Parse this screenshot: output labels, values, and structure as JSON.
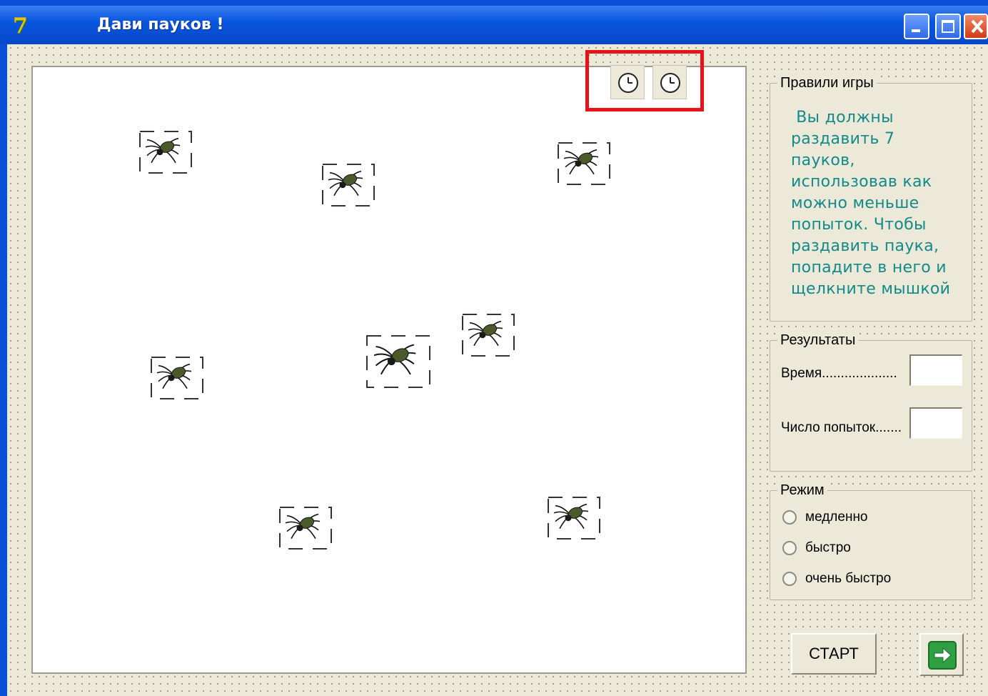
{
  "window": {
    "title": "Дави пауков !",
    "app_icon": "delphi-7-icon",
    "buttons": [
      "minimize-icon",
      "maximize-icon",
      "close-icon"
    ]
  },
  "toolbar": {
    "timer_icons": [
      "clock-icon",
      "clock-icon"
    ],
    "highlight_color": "#e8121a"
  },
  "game": {
    "spider_count": 8,
    "spider_icon": "spider-icon"
  },
  "rules": {
    "caption": "Правили игры",
    "lines": [
      " Вы должны",
      "раздавить 7",
      "пауков,",
      "использовав как",
      "можно меньше",
      "попыток. Чтобы",
      "раздавить паука,",
      "попадите в него и",
      "щелкните мышкой"
    ],
    "text_color": "#128a8a"
  },
  "results": {
    "caption": "Результаты",
    "time_label": "Время....................",
    "time_value": "",
    "attempts_label": "Число попыток.......",
    "attempts_value": ""
  },
  "mode": {
    "caption": "Режим",
    "options": [
      "медленно",
      "быстро",
      "очень быстро"
    ]
  },
  "buttons": {
    "start_label": "СТАРТ",
    "next_icon": "arrow-right-icon",
    "next_color": "#2ea043"
  }
}
